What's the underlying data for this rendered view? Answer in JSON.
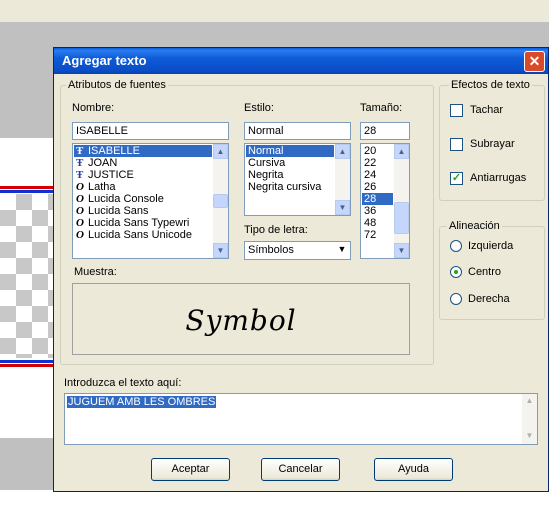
{
  "dialog": {
    "title": "Agregar texto",
    "close_label": "✕"
  },
  "font_attrs": {
    "group_label": "Atributos de fuentes",
    "name_label": "Nombre:",
    "name_value": "ISABELLE",
    "style_label": "Estilo:",
    "style_value": "Normal",
    "size_label": "Tamaño:",
    "size_value": "28",
    "fonts": [
      {
        "name": "ISABELLE",
        "icon": "truetype-icon",
        "selected": true
      },
      {
        "name": "JOAN",
        "icon": "truetype-icon",
        "selected": false
      },
      {
        "name": "JUSTICE",
        "icon": "truetype-icon",
        "selected": false
      },
      {
        "name": "Latha",
        "icon": "opentype-icon",
        "selected": false
      },
      {
        "name": "Lucida Console",
        "icon": "opentype-icon",
        "selected": false
      },
      {
        "name": "Lucida Sans",
        "icon": "opentype-icon",
        "selected": false
      },
      {
        "name": "Lucida Sans Typewri",
        "icon": "opentype-icon",
        "selected": false
      },
      {
        "name": "Lucida Sans Unicode",
        "icon": "opentype-icon",
        "selected": false
      }
    ],
    "styles": [
      {
        "name": "Normal",
        "selected": true
      },
      {
        "name": "Cursiva",
        "selected": false
      },
      {
        "name": "Negrita",
        "selected": false
      },
      {
        "name": "Negrita cursiva",
        "selected": false
      }
    ],
    "sizes": [
      {
        "name": "20",
        "selected": false
      },
      {
        "name": "22",
        "selected": false
      },
      {
        "name": "24",
        "selected": false
      },
      {
        "name": "26",
        "selected": false
      },
      {
        "name": "28",
        "selected": true
      },
      {
        "name": "36",
        "selected": false
      },
      {
        "name": "48",
        "selected": false
      },
      {
        "name": "72",
        "selected": false
      }
    ],
    "type_label": "Tipo de letra:",
    "type_value": "Símbolos",
    "sample_label": "Muestra:",
    "sample_text": "Symbol"
  },
  "effects": {
    "group_label": "Efectos de texto",
    "strikeout": {
      "label": "Tachar",
      "checked": false
    },
    "underline": {
      "label": "Subrayar",
      "checked": false
    },
    "antialias": {
      "label": "Antiarrugas",
      "checked": true
    }
  },
  "alignment": {
    "group_label": "Alineación",
    "left": {
      "label": "Izquierda",
      "checked": false
    },
    "center": {
      "label": "Centro",
      "checked": true
    },
    "right": {
      "label": "Derecha",
      "checked": false
    }
  },
  "text_entry": {
    "label": "Introduzca el texto aquí:",
    "value": "JUGUEM AMB LES OMBRES"
  },
  "buttons": {
    "ok": "Aceptar",
    "cancel": "Cancelar",
    "help": "Ayuda"
  },
  "colors": {
    "title_bar": "#0a5fd8",
    "selection": "#316ac5",
    "dialog_bg": "#ece9d8",
    "close_button": "#d94a2a"
  }
}
